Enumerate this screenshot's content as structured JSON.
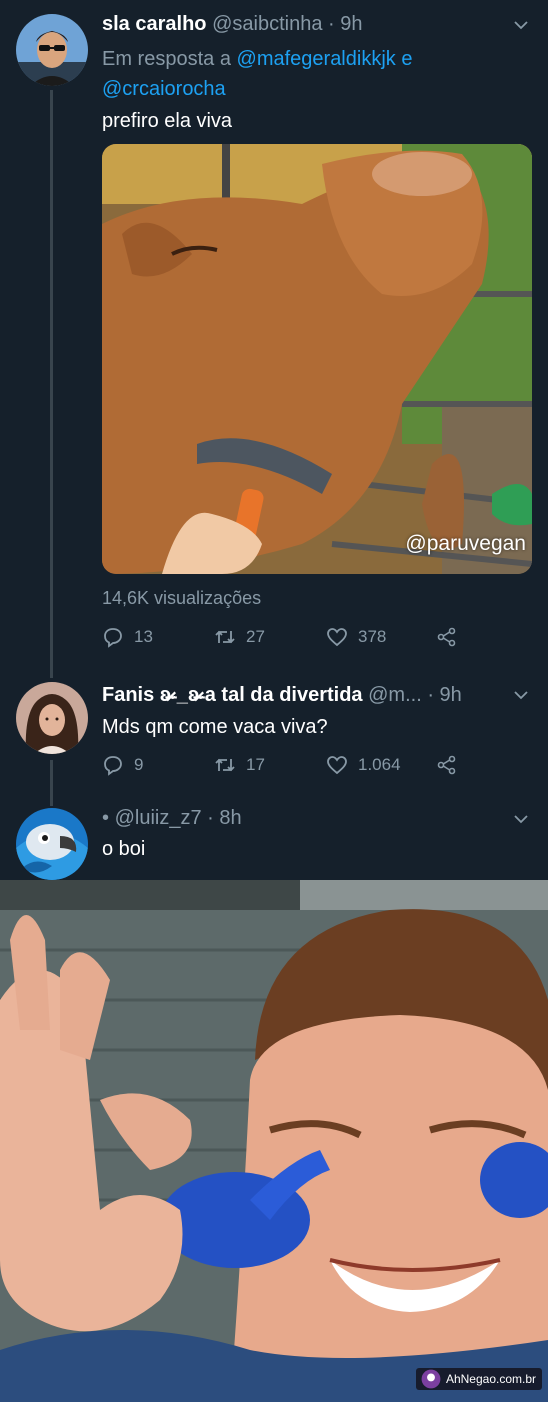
{
  "tweets": [
    {
      "name": "sla caralho",
      "handle": "@saibctinha",
      "time": "· 9h",
      "reply_prefix": "Em resposta a",
      "mention_1": "@mafegeraldikkjk",
      "reply_joiner": "e",
      "mention_2": "@crcaiorocha",
      "text": "prefiro ela viva",
      "media_watermark": "@paruvegan",
      "views": "14,6K visualizações",
      "replies": "13",
      "retweets": "27",
      "likes": "378",
      "avatar_icon": "user-avatar-photo"
    },
    {
      "name": "Fanis ʚ̴̶̷̷ _ʚ̴̶̷̷ a tal da divertida",
      "handle": "@m...",
      "time": "· 9h",
      "text": "Mds qm come vaca viva?",
      "replies": "9",
      "retweets": "17",
      "likes": "1.064",
      "avatar_icon": "user-avatar-photo"
    },
    {
      "name": "•",
      "handle": "@luiiz_z7",
      "time": "· 8h",
      "text": "o boi",
      "avatar_icon": "parrot-avatar"
    }
  ],
  "meme": {
    "watermark": "AhNegao.com.br"
  },
  "colors": {
    "background": "#15202b",
    "muted": "#8899a6",
    "accent": "#1da1f2",
    "thread_line": "#38444d"
  }
}
